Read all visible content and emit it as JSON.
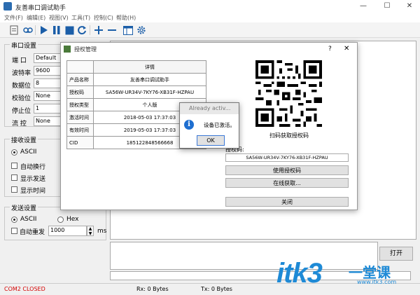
{
  "window": {
    "title": "友善串口调试助手",
    "minimize": "—",
    "maximize": "☐",
    "close": "✕"
  },
  "menu": [
    "文件(F)",
    "编辑(E)",
    "视图(V)",
    "工具(T)",
    "控制(C)",
    "帮助(H)"
  ],
  "toolbar": [
    "document-icon",
    "tape-icon",
    "play-icon",
    "pause-icon",
    "stop-icon",
    "refresh-icon",
    "plus-icon",
    "minus-icon",
    "window-icon",
    "gear-icon"
  ],
  "serial": {
    "group_label": "串口设置",
    "rows": [
      {
        "label": "端 口",
        "value": "Default"
      },
      {
        "label": "波特率",
        "value": "9600"
      },
      {
        "label": "数据位",
        "value": "8"
      },
      {
        "label": "校验位",
        "value": "None"
      },
      {
        "label": "停止位",
        "value": "1"
      },
      {
        "label": "流 控",
        "value": "None"
      }
    ]
  },
  "receive": {
    "group_label": "接收设置",
    "ascii": "ASCII",
    "auto_wrap": "自动换行",
    "show_send": "显示发送",
    "show_time": "显示时间"
  },
  "send": {
    "group_label": "发送设置",
    "ascii": "ASCII",
    "hex": "Hex",
    "auto_resend": "自动重发",
    "interval": "1000",
    "unit": "ms"
  },
  "open_button": "打开",
  "status": {
    "port": "COM2 CLOSED",
    "rx": "Rx: 0 Bytes",
    "tx": "Tx: 0 Bytes",
    "port_color": "#d40000"
  },
  "auth_dialog": {
    "title": "授权管理",
    "help": "?",
    "close": "✕",
    "table_header": "详情",
    "rows": [
      {
        "key": "产品名称",
        "value": "友善串口调试助手"
      },
      {
        "key": "授权码",
        "value": "SA56W-UR34V-7KY76-XB31F-HZPAU"
      },
      {
        "key": "授权类型",
        "value": "个人版"
      },
      {
        "key": "激活时间",
        "value": "2018-05-03 17:37:03"
      },
      {
        "key": "有效时间",
        "value": "2019-05-03 17:37:03"
      },
      {
        "key": "CID",
        "value": "185122848566668"
      }
    ],
    "qr_caption": "扫码获取授权码",
    "code_label": "授权码:",
    "code_value": "SA56W-UR34V-7KY76-XB31F-HZPAU",
    "use_code": "使用授权码",
    "online": "在线获取...",
    "close_btn": "关闭"
  },
  "msgbox": {
    "title": "Already activ...",
    "text": "设备已激活。",
    "ok": "OK",
    "info_glyph": "i"
  },
  "watermark": {
    "text": "itk3",
    "tail": "一堂课",
    "url": "www.itk3.com",
    "color": "#1e8ad6"
  }
}
